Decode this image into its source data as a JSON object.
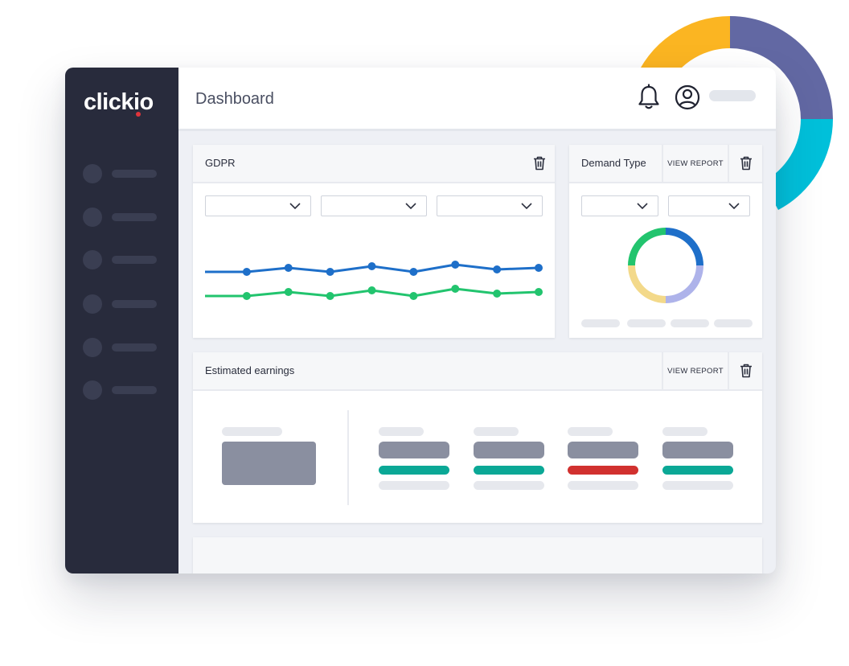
{
  "app": {
    "logo_text_main": "click",
    "logo_text_accent": "io"
  },
  "header": {
    "title": "Dashboard",
    "icons": [
      "bell-icon",
      "user-icon"
    ]
  },
  "gdpr_card": {
    "title": "GDPR",
    "filters": [
      "",
      "",
      ""
    ],
    "chart_data": {
      "type": "line",
      "series": [
        {
          "color": "#1e6fc9",
          "values": [
            0,
            0,
            5,
            0,
            7,
            0,
            9,
            3,
            5
          ]
        },
        {
          "color": "#22c46e",
          "values": [
            0,
            0,
            5,
            0,
            7,
            0,
            9,
            3,
            5
          ]
        }
      ]
    }
  },
  "demand_card": {
    "title": "Demand Type",
    "view_report_label": "VIEW REPORT",
    "filters": [
      "",
      ""
    ],
    "chart_data": {
      "type": "pie",
      "slices": [
        {
          "value": 25,
          "color": "#1e6fc9"
        },
        {
          "value": 25,
          "color": "#aeb3ea"
        },
        {
          "value": 25,
          "color": "#f3d98a"
        },
        {
          "value": 25,
          "color": "#22c46e"
        }
      ]
    }
  },
  "earnings_card": {
    "title": "Estimated earnings",
    "view_report_label": "VIEW REPORT",
    "metric_statuses": [
      "positive",
      "positive",
      "negative",
      "positive"
    ]
  },
  "colors": {
    "sidebar": "#282b3c",
    "accent_blue": "#1e6fc9",
    "accent_green": "#22c46e",
    "positive": "#0ba896",
    "negative": "#d1312f",
    "ring_yellow": "#fbb522",
    "ring_indigo": "#6268a3",
    "ring_cyan": "#00c0da"
  }
}
